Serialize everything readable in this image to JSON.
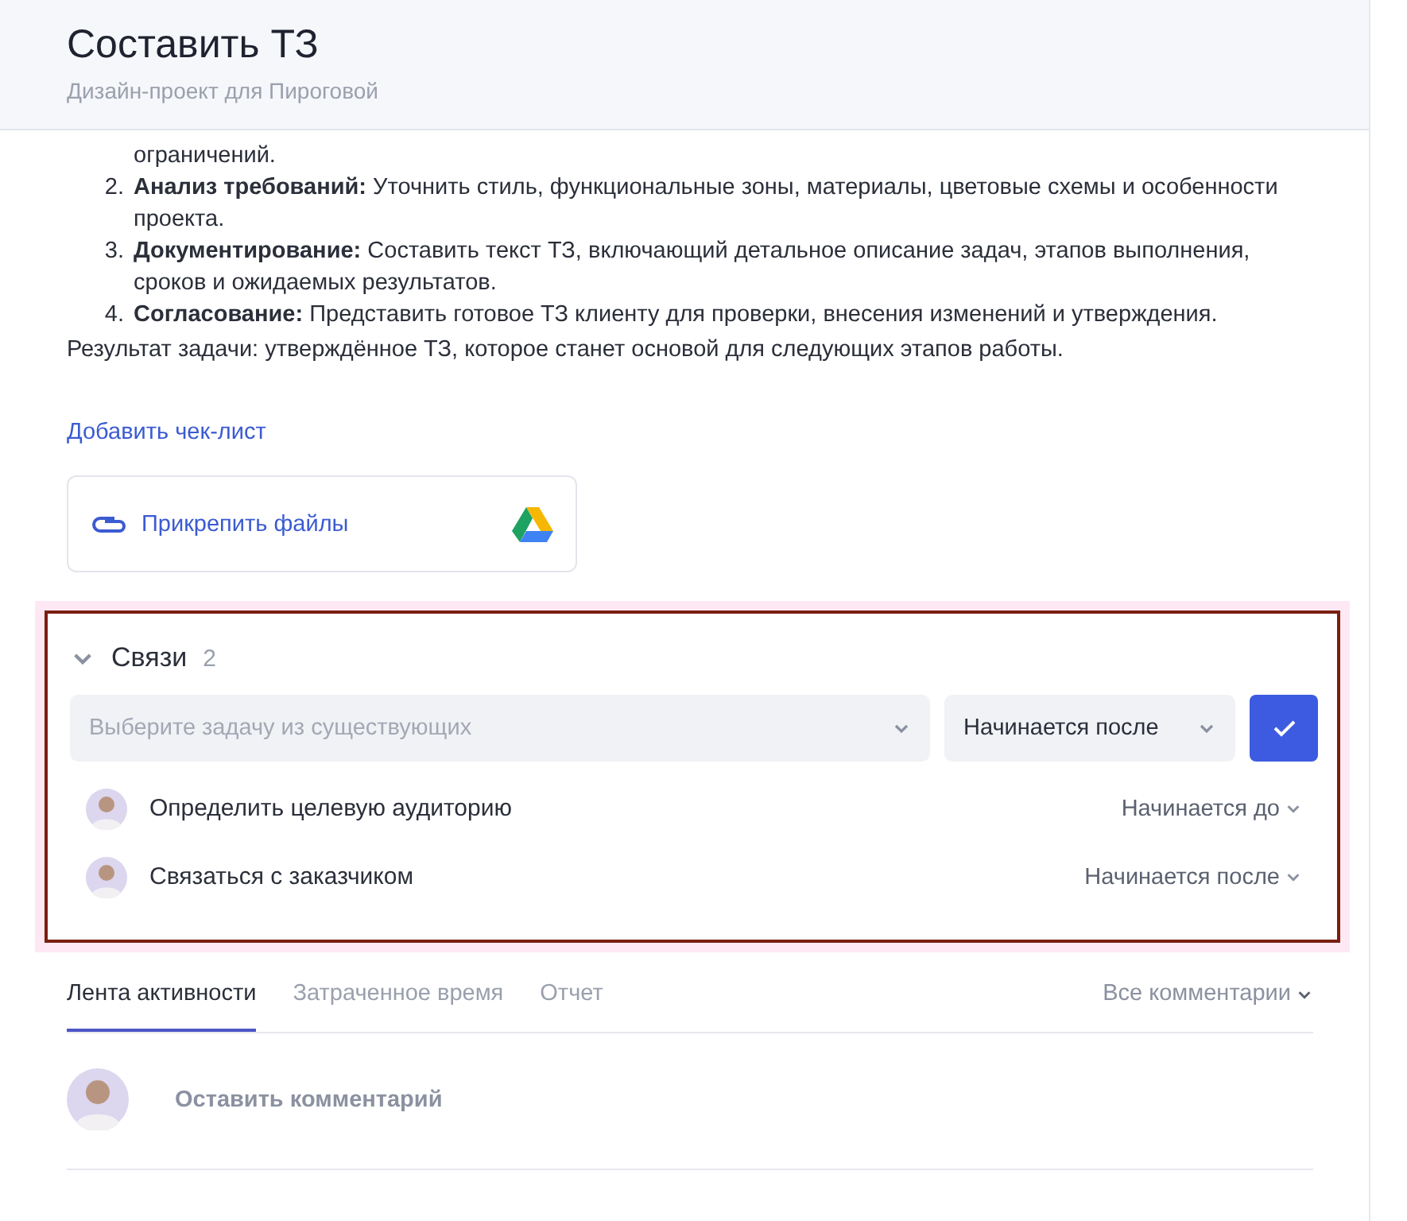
{
  "header": {
    "title": "Составить ТЗ",
    "subtitle": "Дизайн-проект для Пироговой"
  },
  "description": {
    "continuation": "ограничений.",
    "steps": [
      {
        "number": "2.",
        "text": "**Анализ требований:** Уточнить стиль, функциональные зоны, материалы, цветовые схемы и особенности проекта."
      },
      {
        "number": "3.",
        "text": "**Документирование:** Составить текст ТЗ, включающий детальное описание задач, этапов выполнения, сроков и ожидаемых результатов."
      },
      {
        "number": "4.",
        "text": "**Согласование:** Представить готовое ТЗ клиенту для проверки, внесения изменений и утверждения."
      }
    ],
    "result": "Результат задачи: утверждённое ТЗ, которое станет основой для следующих этапов работы."
  },
  "add_checklist": "Добавить чек-лист",
  "attach": {
    "label": "Прикрепить файлы"
  },
  "links": {
    "title": "Связи",
    "count": "2",
    "expanded": true,
    "highlighted": true,
    "task_select": {
      "placeholder": "Выберите задачу из существующих"
    },
    "type_select": {
      "value": "Начинается после"
    },
    "items": [
      {
        "name": "Определить целевую аудиторию",
        "relation": "Начинается до"
      },
      {
        "name": "Связаться с заказчиком",
        "relation": "Начинается после"
      }
    ]
  },
  "activity": {
    "tabs": [
      {
        "label": "Лента активности",
        "selected": true
      },
      {
        "label": "Затраченное время",
        "selected": false
      },
      {
        "label": "Отчет",
        "selected": false
      }
    ],
    "filter": "Все комментарии",
    "comment": {
      "placeholder": "Оставить комментарий"
    }
  }
}
